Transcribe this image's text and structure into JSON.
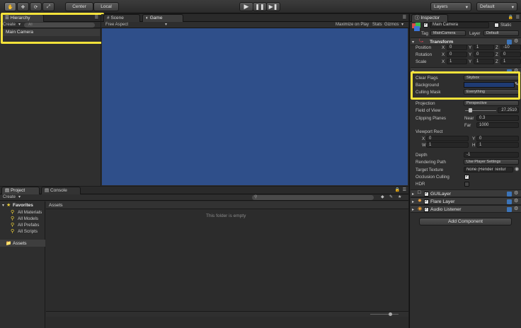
{
  "toolbar": {
    "center_label": "Center",
    "local_label": "Local",
    "layers_label": "Layers",
    "layout_label": "Default",
    "tool_icons": [
      "hand-icon",
      "move-icon",
      "rotate-icon",
      "scale-icon"
    ],
    "play_icons": [
      "play-icon",
      "pause-icon",
      "step-icon"
    ]
  },
  "hierarchy": {
    "tab": "Hierarchy",
    "create_label": "Create",
    "search_placeholder": "All",
    "items": [
      "Main Camera"
    ]
  },
  "scene_tabs": {
    "scene": "Scene",
    "game": "Game"
  },
  "game_bar": {
    "aspect": "Free Aspect",
    "maximize": "Maximize on Play",
    "stats": "Stats",
    "gizmos": "Gizmos"
  },
  "game_view_color": "#2f4f8a",
  "project": {
    "tab_project": "Project",
    "tab_console": "Console",
    "create_label": "Create",
    "favorites_label": "Favorites",
    "favorites": [
      "All Materials",
      "All Models",
      "All Prefabs",
      "All Scripts"
    ],
    "assets_label": "Assets",
    "assets_header": "Assets",
    "empty_text": "This folder is empty"
  },
  "inspector": {
    "tab": "Inspector",
    "object_name": "Main Camera",
    "static_label": "Static",
    "tag_label": "Tag",
    "tag_value": "MainCamera",
    "layer_label": "Layer",
    "layer_value": "Default",
    "transform": {
      "title": "Transform",
      "position_label": "Position",
      "rotation_label": "Rotation",
      "scale_label": "Scale",
      "position": [
        "0",
        "1",
        "-10"
      ],
      "rotation": [
        "0",
        "0",
        "0"
      ],
      "scale": [
        "1",
        "1",
        "1"
      ],
      "axis_x": "X",
      "axis_y": "Y",
      "axis_z": "Z"
    },
    "camera": {
      "clear_flags_label": "Clear Flags",
      "clear_flags_value": "Skybox",
      "background_label": "Background",
      "background_color": "#1f3b73",
      "culling_mask_label": "Culling Mask",
      "culling_mask_value": "Everything",
      "projection_label": "Projection",
      "projection_value": "Perspective",
      "fov_label": "Field of View",
      "fov_value": "27.2510",
      "fov_fraction": 0.15,
      "clipping_label": "Clipping Planes",
      "near_label": "Near",
      "near_value": "0.3",
      "far_label": "Far",
      "far_value": "1000",
      "viewport_label": "Viewport Rect",
      "vp_x_label": "X",
      "vp_x": "0",
      "vp_y_label": "Y",
      "vp_y": "0",
      "vp_w_label": "W",
      "vp_w": "1",
      "vp_h_label": "H",
      "vp_h": "1",
      "depth_label": "Depth",
      "depth_value": "-1",
      "rendering_path_label": "Rendering Path",
      "rendering_path_value": "Use Player Settings",
      "target_texture_label": "Target Texture",
      "target_texture_value": "None (Render Textur",
      "occlusion_label": "Occlusion Culling",
      "hdr_label": "HDR"
    },
    "components": [
      "GUILayer",
      "Flare Layer",
      "Audio Listener"
    ],
    "add_component": "Add Component"
  },
  "highlight_color": "#f4e23a"
}
